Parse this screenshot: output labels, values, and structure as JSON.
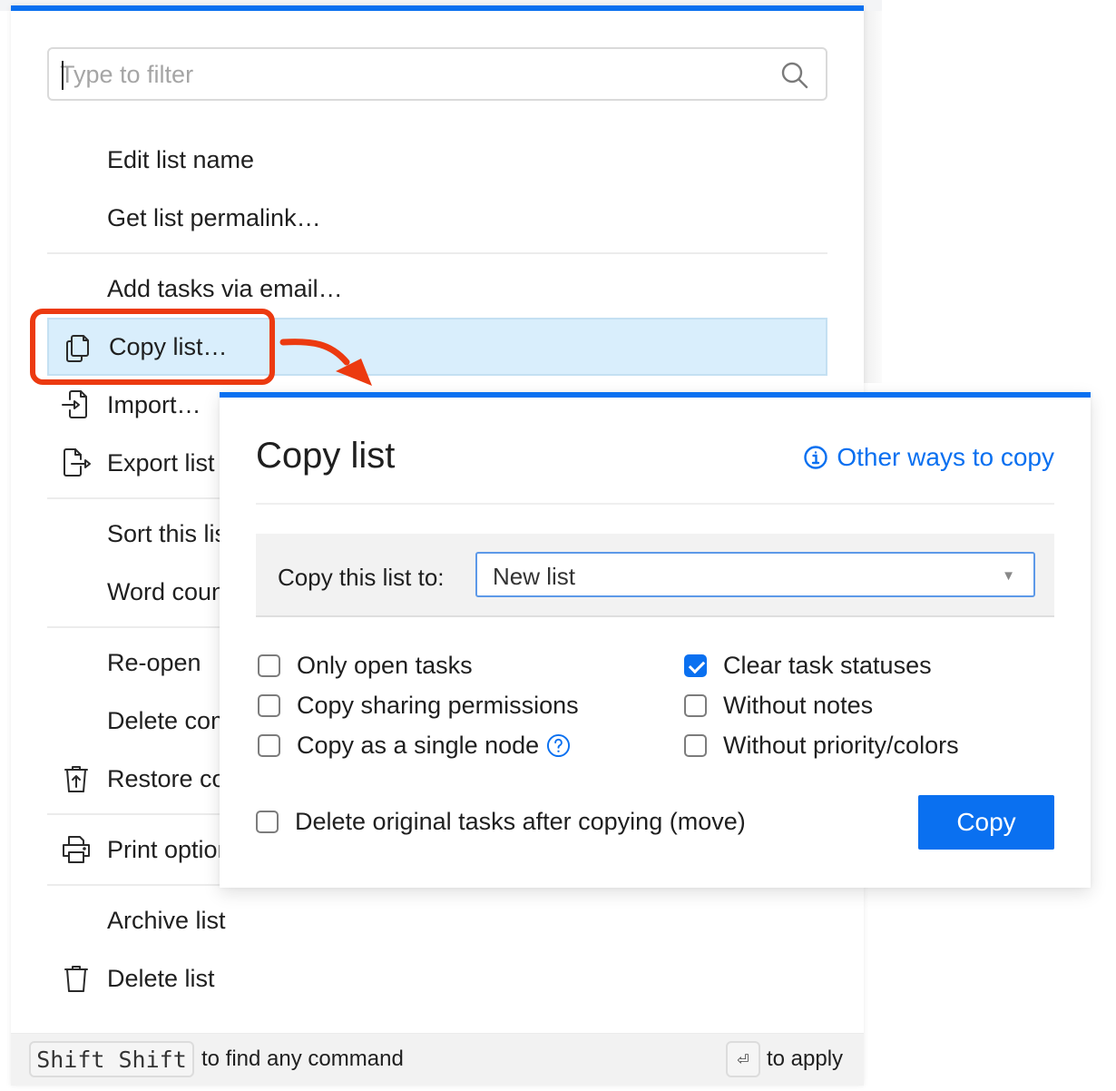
{
  "palette": {
    "filter": {
      "placeholder": "Type to filter",
      "value": ""
    },
    "items": [
      {
        "label": "Edit list name",
        "icon": "none"
      },
      {
        "label": "Get list permalink…",
        "icon": "none"
      },
      {
        "label": "Add tasks via email…",
        "icon": "none"
      },
      {
        "label": "Copy list…",
        "icon": "copy-icon",
        "selected": true
      },
      {
        "label": "Import…",
        "icon": "import-icon"
      },
      {
        "label": "Export list",
        "icon": "export-icon"
      },
      {
        "label": "Sort this list",
        "icon": "none"
      },
      {
        "label": "Word count",
        "icon": "none"
      },
      {
        "label": "Re-open",
        "icon": "none"
      },
      {
        "label": "Delete completed",
        "icon": "none"
      },
      {
        "label": "Restore completed",
        "icon": "restore-trash-icon"
      },
      {
        "label": "Print options",
        "icon": "printer-icon"
      },
      {
        "label": "Archive list",
        "icon": "none"
      },
      {
        "label": "Delete list",
        "icon": "trash-icon"
      }
    ],
    "footer": {
      "shortcut_key": "Shift Shift",
      "shortcut_text": "to find any command",
      "apply_key": "⏎",
      "apply_text": "to apply"
    }
  },
  "dialog": {
    "title": "Copy list",
    "other_ways_link": "Other ways to copy",
    "target_label": "Copy this list to:",
    "target_value": "New list",
    "options_left": [
      {
        "label": "Only open tasks",
        "checked": false
      },
      {
        "label": "Copy sharing permissions",
        "checked": false
      },
      {
        "label": "Copy as a single node",
        "checked": false,
        "help": true
      }
    ],
    "options_right": [
      {
        "label": "Clear task statuses",
        "checked": true
      },
      {
        "label": "Without notes",
        "checked": false
      },
      {
        "label": "Without priority/colors",
        "checked": false
      }
    ],
    "move_option": {
      "label": "Delete original tasks after copying (move)",
      "checked": false
    },
    "copy_button": "Copy"
  },
  "colors": {
    "accent": "#0a70f0",
    "selected_bg": "#d9eefc",
    "annotation": "#ec3a10"
  }
}
